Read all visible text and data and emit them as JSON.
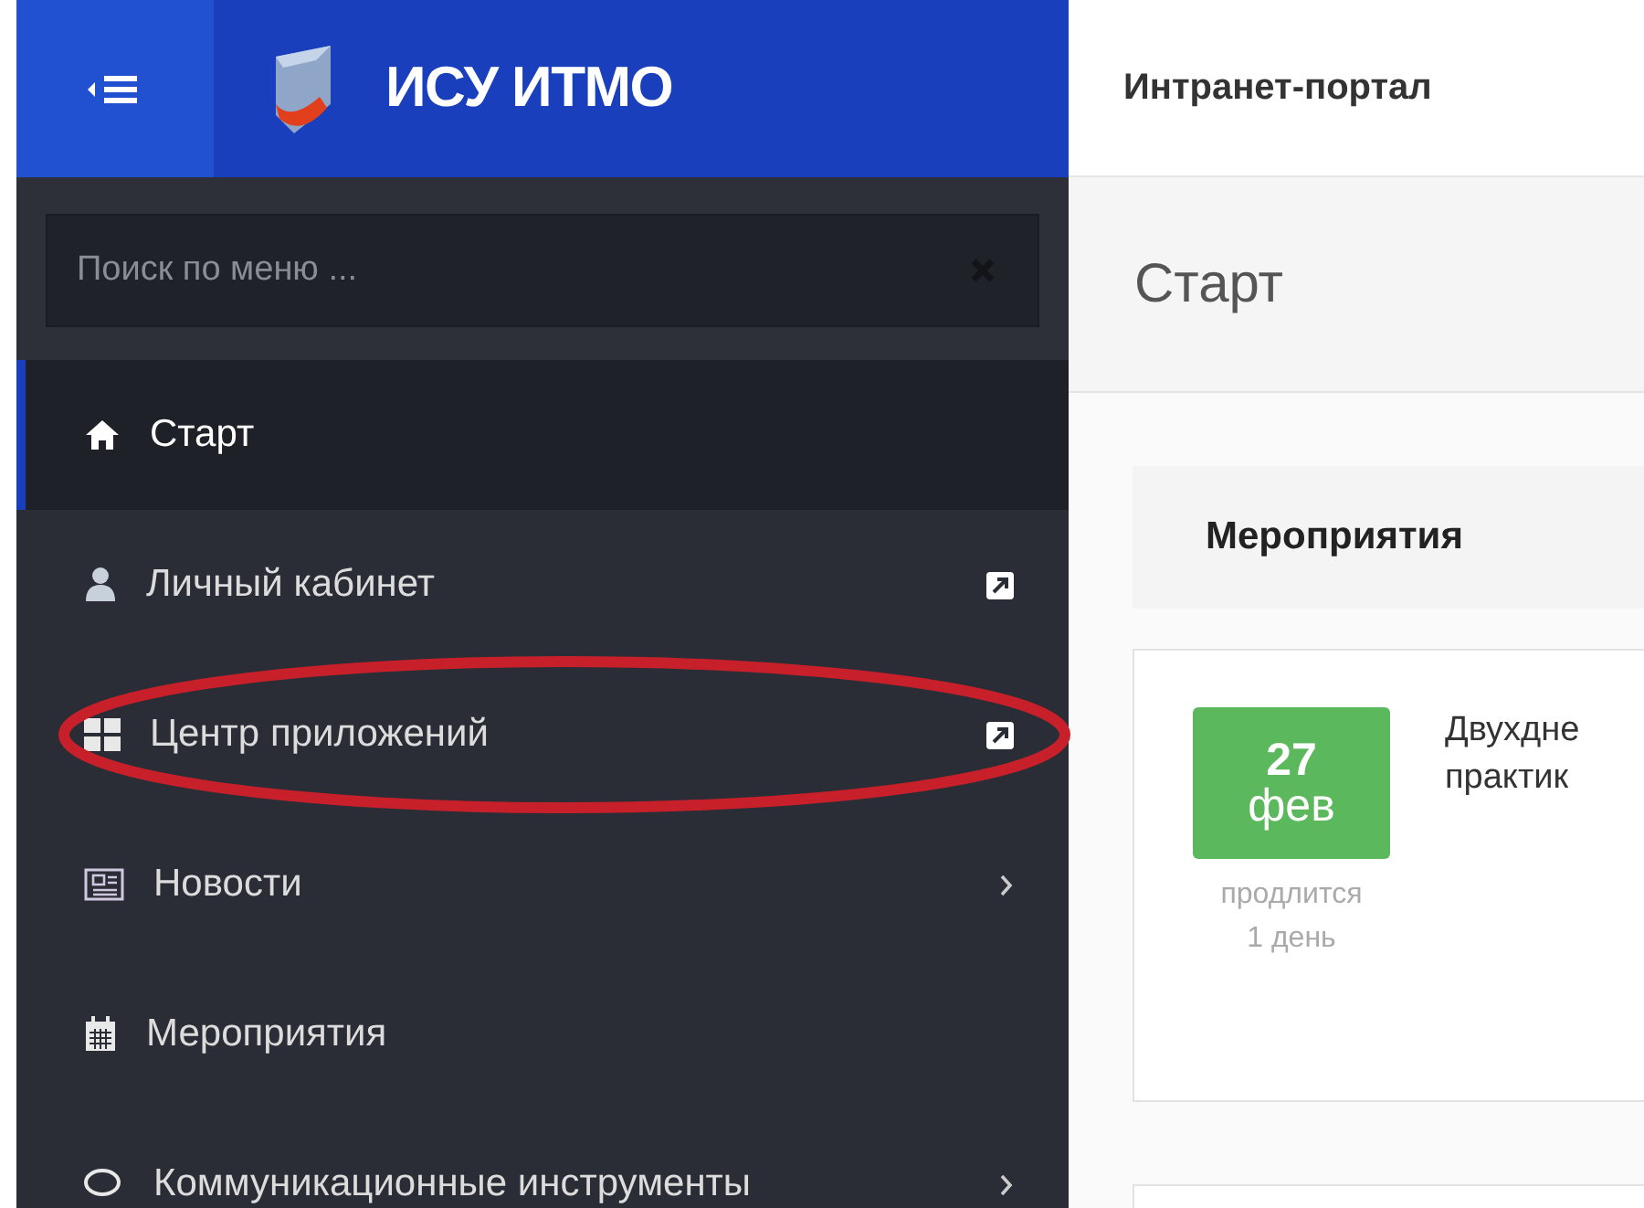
{
  "brand": {
    "title": "ИСУ ИТМО"
  },
  "search": {
    "placeholder": "Поиск по меню ..."
  },
  "menu": [
    {
      "label": "Старт",
      "selected": true,
      "circled": false
    },
    {
      "label": "Личный кабинет",
      "selected": false,
      "circled": false
    },
    {
      "label": "Центр приложений",
      "selected": false,
      "circled": true
    },
    {
      "label": "Новости",
      "selected": false,
      "circled": false
    },
    {
      "label": "Мероприятия",
      "selected": false,
      "circled": false
    },
    {
      "label": "Коммуникационные инструменты",
      "selected": false,
      "circled": false
    }
  ],
  "topbar": {
    "title": "Интранет-портал"
  },
  "page": {
    "title": "Старт"
  },
  "events": {
    "title": "Мероприятия",
    "items": [
      {
        "day": "27",
        "month": "фев",
        "duration_label": "продлится",
        "duration": "1 день",
        "title_lines": [
          "Двухдне",
          "практик"
        ]
      }
    ]
  }
}
